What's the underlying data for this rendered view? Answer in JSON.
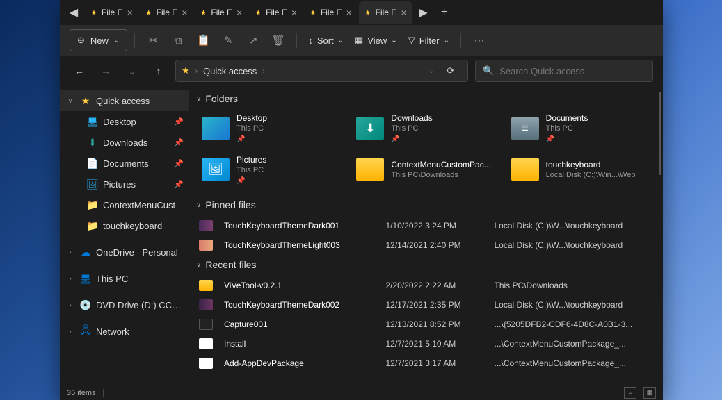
{
  "tabs": {
    "prev": "◀",
    "next": "▶",
    "add": "+",
    "items": [
      {
        "label": "File E",
        "active": false
      },
      {
        "label": "File E",
        "active": false
      },
      {
        "label": "File E",
        "active": false
      },
      {
        "label": "File E",
        "active": false
      },
      {
        "label": "File E",
        "active": false
      },
      {
        "label": "File E",
        "active": true
      }
    ]
  },
  "toolbar": {
    "new": "New",
    "sort": "Sort",
    "view": "View",
    "filter": "Filter"
  },
  "address": {
    "location": "Quick access",
    "search_placeholder": "Search Quick access"
  },
  "sidebar": {
    "items": [
      {
        "label": "Quick access",
        "icon": "★",
        "color": "#ffc83d",
        "expand": "∨",
        "active": true,
        "pin": false,
        "level": 0
      },
      {
        "label": "Desktop",
        "icon": "🖥",
        "color": "#29b6f6",
        "expand": "",
        "active": false,
        "pin": true,
        "level": 1
      },
      {
        "label": "Downloads",
        "icon": "⬇",
        "color": "#26a69a",
        "expand": "",
        "active": false,
        "pin": true,
        "level": 1
      },
      {
        "label": "Documents",
        "icon": "📄",
        "color": "#b0bec5",
        "expand": "",
        "active": false,
        "pin": true,
        "level": 1
      },
      {
        "label": "Pictures",
        "icon": "🖼",
        "color": "#29b6f6",
        "expand": "",
        "active": false,
        "pin": true,
        "level": 1
      },
      {
        "label": "ContextMenuCust",
        "icon": "📁",
        "color": "#ffb300",
        "expand": "",
        "active": false,
        "pin": false,
        "level": 1
      },
      {
        "label": "touchkeyboard",
        "icon": "📁",
        "color": "#ffb300",
        "expand": "",
        "active": false,
        "pin": false,
        "level": 1
      },
      {
        "label": "OneDrive - Personal",
        "icon": "☁",
        "color": "#0078d4",
        "expand": "›",
        "active": false,
        "pin": false,
        "level": 0
      },
      {
        "label": "This PC",
        "icon": "🖥",
        "color": "#0078d4",
        "expand": "›",
        "active": false,
        "pin": false,
        "level": 0
      },
      {
        "label": "DVD Drive (D:) CCCO",
        "icon": "💿",
        "color": "#9e9e9e",
        "expand": "›",
        "active": false,
        "pin": false,
        "level": 0
      },
      {
        "label": "Network",
        "icon": "🖧",
        "color": "#0078d4",
        "expand": "›",
        "active": false,
        "pin": false,
        "level": 0
      }
    ]
  },
  "sections": {
    "folders": "Folders",
    "pinned": "Pinned files",
    "recent": "Recent files"
  },
  "folders": [
    {
      "name": "Desktop",
      "path": "This PC",
      "pin": true,
      "cls": "ic-desktop",
      "glyph": ""
    },
    {
      "name": "Downloads",
      "path": "This PC",
      "pin": true,
      "cls": "ic-downloads",
      "glyph": "⬇"
    },
    {
      "name": "Documents",
      "path": "This PC",
      "pin": true,
      "cls": "ic-documents",
      "glyph": "≡"
    },
    {
      "name": "Pictures",
      "path": "This PC",
      "pin": true,
      "cls": "ic-pictures",
      "glyph": "🖼"
    },
    {
      "name": "ContextMenuCustomPac...",
      "path": "This PC\\Downloads",
      "pin": false,
      "cls": "ic-folder",
      "glyph": ""
    },
    {
      "name": "touchkeyboard",
      "path": "Local Disk (C:)\\Win...\\Web",
      "pin": false,
      "cls": "ic-folder",
      "glyph": ""
    }
  ],
  "pinned_files": [
    {
      "name": "TouchKeyboardThemeDark001",
      "date": "1/10/2022 3:24 PM",
      "loc": "Local Disk (C:)\\W...\\touchkeyboard",
      "cls": "ic-dark"
    },
    {
      "name": "TouchKeyboardThemeLight003",
      "date": "12/14/2021 2:40 PM",
      "loc": "Local Disk (C:)\\W...\\touchkeyboard",
      "cls": "ic-light"
    }
  ],
  "recent_files": [
    {
      "name": "ViVeTool-v0.2.1",
      "date": "2/20/2022 2:22 AM",
      "loc": "This PC\\Downloads",
      "cls": "ic-folder"
    },
    {
      "name": "TouchKeyboardThemeDark002",
      "date": "12/17/2021 2:35 PM",
      "loc": "Local Disk (C:)\\W...\\touchkeyboard",
      "cls": "ic-dark2"
    },
    {
      "name": "Capture001",
      "date": "12/13/2021 8:52 PM",
      "loc": "...\\{5205DFB2-CDF6-4D8C-A0B1-3...",
      "cls": "ic-cap"
    },
    {
      "name": "Install",
      "date": "12/7/2021 5:10 AM",
      "loc": "...\\ContextMenuCustomPackage_...",
      "cls": "ic-file"
    },
    {
      "name": "Add-AppDevPackage",
      "date": "12/7/2021 3:17 AM",
      "loc": "...\\ContextMenuCustomPackage_...",
      "cls": "ic-file"
    }
  ],
  "status": {
    "count": "35 items"
  }
}
